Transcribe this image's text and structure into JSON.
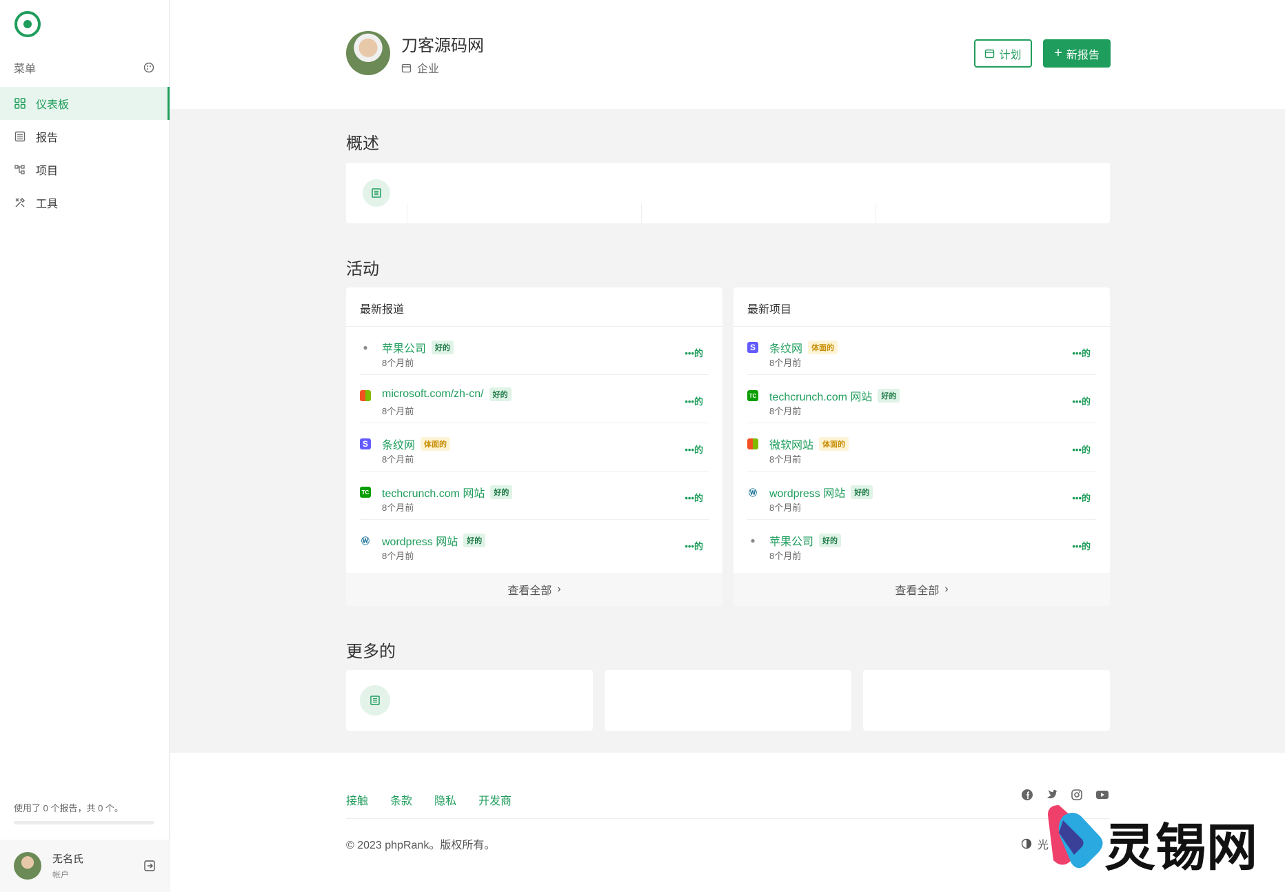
{
  "sidebar": {
    "menu_label": "菜单",
    "items": [
      {
        "label": "仪表板",
        "icon": "dashboard-icon",
        "active": true
      },
      {
        "label": "报告",
        "icon": "report-icon",
        "active": false
      },
      {
        "label": "项目",
        "icon": "project-icon",
        "active": false
      },
      {
        "label": "工具",
        "icon": "tools-icon",
        "active": false
      }
    ],
    "usage_text": "使用了 0 个报告，共 0 个。",
    "user": {
      "name": "无名氏",
      "subtitle": "帐户"
    }
  },
  "header": {
    "company": "刀客源码网",
    "type": "企业",
    "plan_label": "计划",
    "new_report_label": "新报告"
  },
  "overview": {
    "title": "概述"
  },
  "activity": {
    "title": "活动",
    "reports": {
      "title": "最新报道",
      "items": [
        {
          "name": "苹果公司",
          "badge": "好的",
          "badge_type": "good",
          "time": "8个月前",
          "icon": "apple-icon"
        },
        {
          "name": "microsoft.com/zh-cn/",
          "badge": "好的",
          "badge_type": "good",
          "time": "8个月前",
          "icon": "microsoft-icon"
        },
        {
          "name": "条纹网",
          "badge": "体面的",
          "badge_type": "decent",
          "time": "8个月前",
          "icon": "stripe-icon"
        },
        {
          "name": "techcrunch.com 网站",
          "badge": "好的",
          "badge_type": "good",
          "time": "8个月前",
          "icon": "techcrunch-icon"
        },
        {
          "name": "wordpress 网站",
          "badge": "好的",
          "badge_type": "good",
          "time": "8个月前",
          "icon": "wordpress-icon"
        }
      ],
      "more_label": "•••的",
      "view_all": "查看全部"
    },
    "projects": {
      "title": "最新项目",
      "items": [
        {
          "name": "条纹网",
          "badge": "体面的",
          "badge_type": "decent",
          "time": "8个月前",
          "icon": "stripe-icon"
        },
        {
          "name": "techcrunch.com 网站",
          "badge": "好的",
          "badge_type": "good",
          "time": "8个月前",
          "icon": "techcrunch-icon"
        },
        {
          "name": "微软网站",
          "badge": "体面的",
          "badge_type": "decent",
          "time": "8个月前",
          "icon": "microsoft-icon"
        },
        {
          "name": "wordpress 网站",
          "badge": "好的",
          "badge_type": "good",
          "time": "8个月前",
          "icon": "wordpress-icon"
        },
        {
          "name": "苹果公司",
          "badge": "好的",
          "badge_type": "good",
          "time": "8个月前",
          "icon": "apple-icon"
        }
      ],
      "more_label": "•••的",
      "view_all": "查看全部"
    }
  },
  "more": {
    "title": "更多的"
  },
  "footer": {
    "links": [
      "接触",
      "条款",
      "隐私",
      "开发商"
    ],
    "copyright": "© 2023 phpRank。版权所有。",
    "theme_label": "光"
  },
  "watermark": {
    "text": "灵锡网"
  },
  "colors": {
    "accent": "#1f9d5c",
    "good_badge": "#dff3e6",
    "decent_badge": "#fdf3d6"
  }
}
